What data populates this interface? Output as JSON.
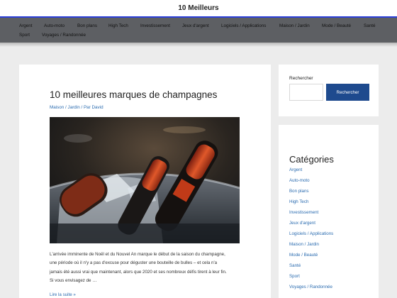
{
  "header": {
    "site_title": "10 Meilleurs"
  },
  "nav": {
    "row1": [
      "Argent",
      "Auto-moto",
      "Bon plans",
      "High Tech",
      "Investissement",
      "Jeux d'argent",
      "Logiciels / Applications",
      "Maison / Jardin",
      "Mode / Beauté",
      "Santé"
    ],
    "row2": [
      "Sport",
      "Voyages / Randonnée"
    ]
  },
  "post": {
    "title": "10 meilleures marques de champagnes",
    "meta": "Maison / Jardin / Par David",
    "image_icon": "champagne-bottles-photo",
    "excerpt_lines": [
      "L'arrivée imminente de Noël et du Nouvel An marque le début de la saison du champagne,",
      "une période où il n'y a pas d'excuse pour déguster une bouteille de bulles – et cela n'a",
      "jamais été aussi vrai que maintenant, alors que 2020 et ses nombreux défis tirent à leur fin.",
      "Si vous envisagez de …"
    ],
    "read_more": "Lire la suite »"
  },
  "sidebar": {
    "search": {
      "label": "Rechercher",
      "placeholder": "",
      "button": "Rechercher"
    },
    "categories": {
      "title": "Catégories",
      "items": [
        "Argent",
        "Auto-moto",
        "Bon plans",
        "High Tech",
        "Investissement",
        "Jeux d'argent",
        "Logiciels / Applications",
        "Maison / Jardin",
        "Mode / Beauté",
        "Santé",
        "Sport",
        "Voyages / Randonnée"
      ]
    }
  },
  "colors": {
    "accent": "#2b3fd8",
    "nav_bg": "#5d5f63",
    "link": "#2b6cb0",
    "button": "#1e4a8e"
  }
}
